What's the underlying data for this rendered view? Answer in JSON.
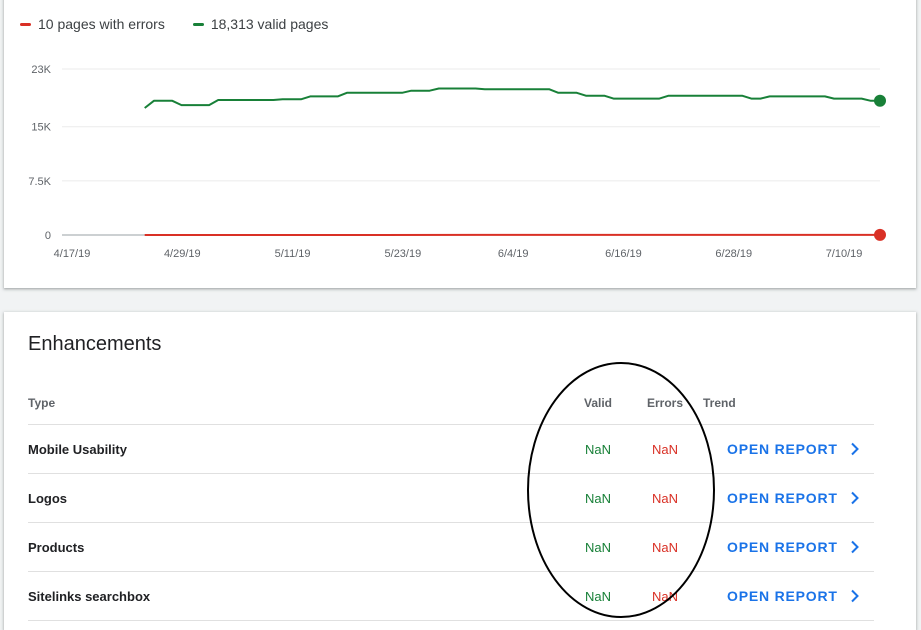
{
  "legend": {
    "errors_label": "10 pages with errors",
    "valid_label": "18,313 valid pages"
  },
  "colors": {
    "errors": "#d93025",
    "valid": "#188038",
    "link": "#1a73e8"
  },
  "chart_data": {
    "type": "line",
    "y_ticks": [
      "23K",
      "15K",
      "7.5K",
      "0"
    ],
    "x_tick_labels": [
      "4/17/19",
      "4/29/19",
      "5/11/19",
      "5/23/19",
      "6/4/19",
      "6/16/19",
      "6/28/19",
      "7/10/19"
    ],
    "ylim": [
      0,
      23000
    ],
    "xlim": [
      "2019-04-17",
      "2019-07-15"
    ],
    "grid": true,
    "legend_position": "top-left",
    "series": [
      {
        "name": "10 pages with errors",
        "color": "#d93025",
        "x": [
          "2019-04-26",
          "2019-05-20",
          "2019-06-01",
          "2019-06-14",
          "2019-06-26",
          "2019-07-06",
          "2019-07-15"
        ],
        "y": [
          0,
          0,
          10,
          15,
          15,
          10,
          10
        ]
      },
      {
        "name": "18,313 valid pages",
        "color": "#188038",
        "x": [
          "2019-04-26",
          "2019-04-27",
          "2019-04-29",
          "2019-04-30",
          "2019-05-03",
          "2019-05-04",
          "2019-05-10",
          "2019-05-11",
          "2019-05-13",
          "2019-05-14",
          "2019-05-17",
          "2019-05-18",
          "2019-05-24",
          "2019-05-25",
          "2019-05-27",
          "2019-05-28",
          "2019-06-01",
          "2019-06-02",
          "2019-06-09",
          "2019-06-10",
          "2019-06-12",
          "2019-06-13",
          "2019-06-15",
          "2019-06-16",
          "2019-06-21",
          "2019-06-22",
          "2019-06-30",
          "2019-07-01",
          "2019-07-02",
          "2019-07-03",
          "2019-07-09",
          "2019-07-10",
          "2019-07-13",
          "2019-07-14",
          "2019-07-15"
        ],
        "y": [
          17600,
          18600,
          18600,
          18000,
          18000,
          18700,
          18700,
          18800,
          18800,
          19200,
          19200,
          19700,
          19700,
          20000,
          20000,
          20300,
          20300,
          20200,
          20200,
          19700,
          19700,
          19300,
          19300,
          18900,
          18900,
          19300,
          19300,
          18900,
          18900,
          19200,
          19200,
          18900,
          18900,
          18600,
          18600
        ]
      }
    ]
  },
  "enhancements": {
    "title": "Enhancements",
    "headers": {
      "type": "Type",
      "valid": "Valid",
      "errors": "Errors",
      "trend": "Trend"
    },
    "open_report_label": "OPEN REPORT",
    "rows": [
      {
        "type": "Mobile Usability",
        "valid": "NaN",
        "errors": "NaN"
      },
      {
        "type": "Logos",
        "valid": "NaN",
        "errors": "NaN"
      },
      {
        "type": "Products",
        "valid": "NaN",
        "errors": "NaN"
      },
      {
        "type": "Sitelinks searchbox",
        "valid": "NaN",
        "errors": "NaN"
      }
    ]
  }
}
